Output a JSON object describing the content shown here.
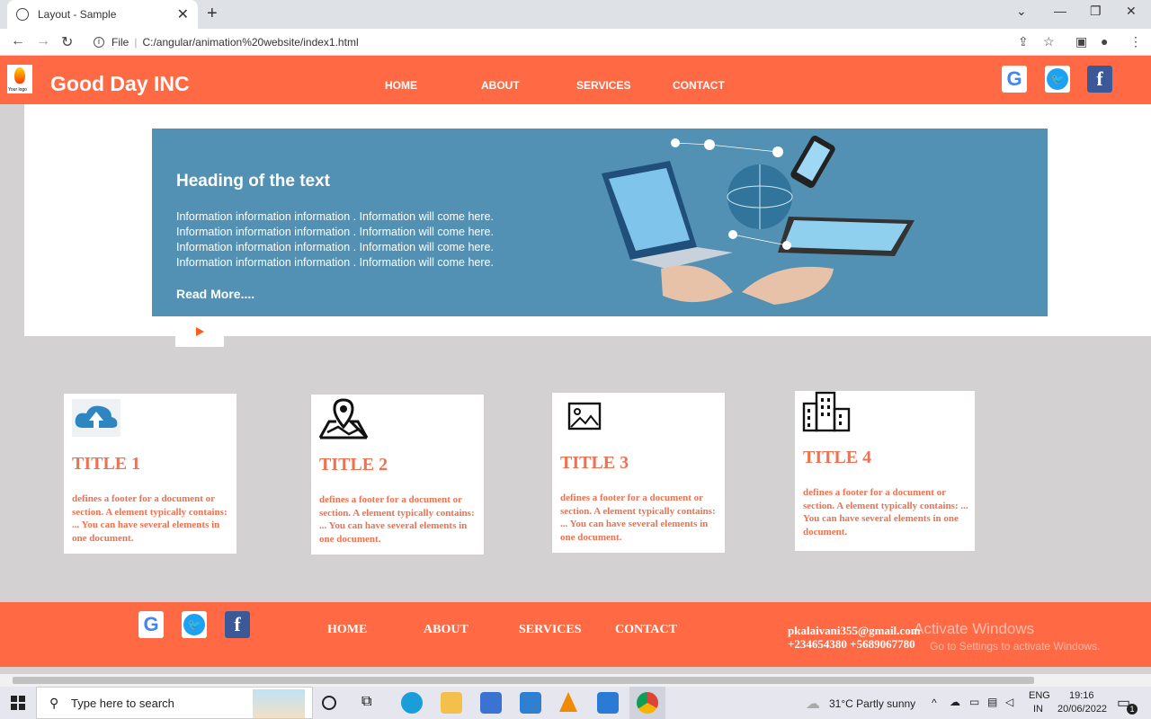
{
  "browser": {
    "tab_title": "Layout - Sample",
    "url_scheme": "File",
    "url": "C:/angular/animation%20website/index1.html"
  },
  "site": {
    "brand": "Good Day INC",
    "logo_text": "Your logo",
    "nav": [
      "HOME",
      "ABOUT",
      "SERVICES",
      "CONTACT"
    ],
    "social": [
      "google-icon",
      "twitter-icon",
      "facebook-icon"
    ],
    "hero": {
      "heading": "Heading of the text",
      "lines": [
        "Information information information . Information will come here.",
        "Information information information . Information will come here.",
        "Information information information . Information will come here.",
        "Information information information . Information will come here."
      ],
      "read_more": "Read More...."
    },
    "cards": [
      {
        "icon": "cloud-upload-icon",
        "title": "TITLE 1",
        "desc": "defines a footer for a document or section. A element typically contains: ... You can have several elements in one document."
      },
      {
        "icon": "map-pin-icon",
        "title": "TITLE 2",
        "desc": "defines a footer for a document or section. A element typically contains: ... You can have several elements in one document."
      },
      {
        "icon": "image-icon",
        "title": "TITLE 3",
        "desc": "defines a footer for a document or section. A element typically contains: ... You can have several elements in one document."
      },
      {
        "icon": "building-icon",
        "title": "TITLE 4",
        "desc": "defines a footer for a document or section. A element typically contains: ... You can have several elements in one document."
      }
    ],
    "footer": {
      "nav": [
        "HOME",
        "ABOUT",
        "SERVICES",
        "CONTACT"
      ],
      "email": "pkalaivani355@gmail.com",
      "phone": "+234654380 +5689067780"
    },
    "watermark": {
      "line1": "Activate Windows",
      "line2": "Go to Settings to activate Windows."
    }
  },
  "taskbar": {
    "search_placeholder": "Type here to search",
    "weather": "31°C  Partly sunny",
    "lang1": "ENG",
    "lang2": "IN",
    "time": "19:16",
    "date": "20/06/2022",
    "notifications": "1"
  },
  "colors": {
    "accent": "#ff6a45",
    "hero": "#5291b3",
    "card_text": "#f0714f"
  }
}
